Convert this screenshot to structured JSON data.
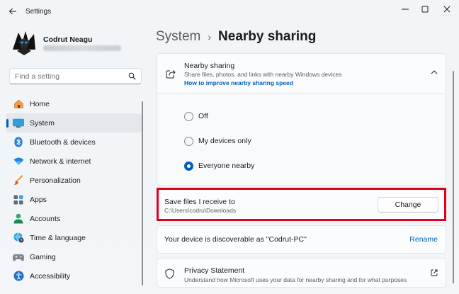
{
  "window": {
    "title": "Settings",
    "controls": [
      "minimize-icon",
      "maximize-icon",
      "close-icon"
    ]
  },
  "user": {
    "name": "Codrut Neagu"
  },
  "search": {
    "placeholder": "Find a setting"
  },
  "sidebar": {
    "items": [
      {
        "label": "Home",
        "icon": "home-icon",
        "selected": false
      },
      {
        "label": "System",
        "icon": "system-icon",
        "selected": true
      },
      {
        "label": "Bluetooth & devices",
        "icon": "bluetooth-icon",
        "selected": false
      },
      {
        "label": "Network & internet",
        "icon": "wifi-icon",
        "selected": false
      },
      {
        "label": "Personalization",
        "icon": "brush-icon",
        "selected": false
      },
      {
        "label": "Apps",
        "icon": "apps-icon",
        "selected": false
      },
      {
        "label": "Accounts",
        "icon": "accounts-icon",
        "selected": false
      },
      {
        "label": "Time & language",
        "icon": "globe-clock-icon",
        "selected": false
      },
      {
        "label": "Gaming",
        "icon": "gamepad-icon",
        "selected": false
      },
      {
        "label": "Accessibility",
        "icon": "accessibility-icon",
        "selected": false
      }
    ]
  },
  "breadcrumb": {
    "parent": "System",
    "separator": "›",
    "current": "Nearby sharing"
  },
  "nearby": {
    "title": "Nearby sharing",
    "description": "Share files, photos, and links with nearby Windows devices",
    "link": "How to improve nearby sharing speed",
    "options": [
      {
        "label": "Off",
        "checked": false
      },
      {
        "label": "My devices only",
        "checked": false
      },
      {
        "label": "Everyone nearby",
        "checked": true
      }
    ]
  },
  "save": {
    "title": "Save files I receive to",
    "path": "C:\\Users\\codru\\Downloads",
    "button": "Change"
  },
  "device": {
    "text": "Your device is discoverable as \"Codrut-PC\"",
    "action": "Rename"
  },
  "privacy": {
    "title": "Privacy Statement",
    "description": "Understand how Microsoft uses your data for nearby sharing and for what purposes"
  },
  "colors": {
    "accent": "#005fb8",
    "highlight": "#e3001b"
  }
}
